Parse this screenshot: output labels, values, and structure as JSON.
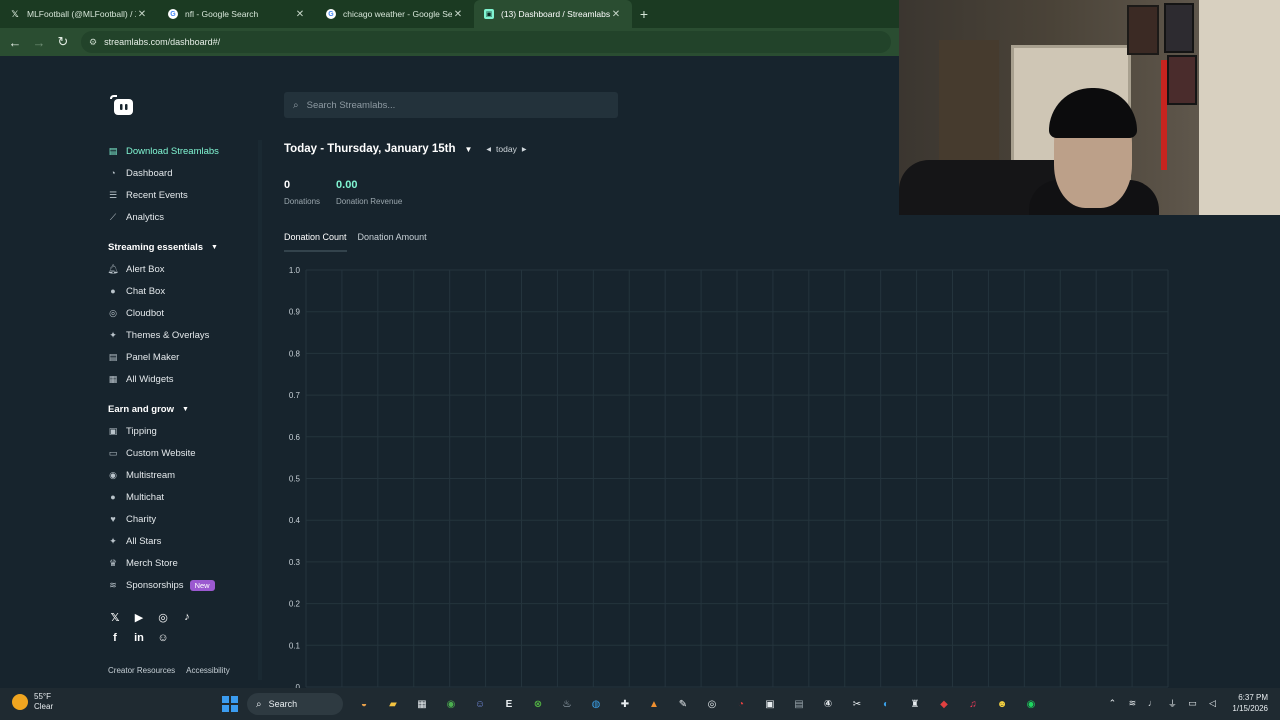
{
  "browser": {
    "tabs": [
      {
        "title": "MLFootball (@MLFootball) / X",
        "icon": "x-icon",
        "active": false
      },
      {
        "title": "nfl - Google Search",
        "icon": "google-icon",
        "active": false
      },
      {
        "title": "chicago weather - Google Search",
        "icon": "google-icon",
        "active": false
      },
      {
        "title": "(13) Dashboard / Streamlabs",
        "icon": "streamlabs-icon",
        "active": true
      }
    ],
    "new_tab_label": "+",
    "url": "streamlabs.com/dashboard#/"
  },
  "search": {
    "placeholder": "Search Streamlabs..."
  },
  "sidebar": {
    "top_items": [
      {
        "label": "Download Streamlabs",
        "icon": "download-icon",
        "highlight": true
      },
      {
        "label": "Dashboard",
        "icon": "dashboard-icon"
      },
      {
        "label": "Recent Events",
        "icon": "list-icon"
      },
      {
        "label": "Analytics",
        "icon": "chart-icon"
      }
    ],
    "streaming_essentials": {
      "title": "Streaming essentials",
      "items": [
        {
          "label": "Alert Box",
          "icon": "bell-icon"
        },
        {
          "label": "Chat Box",
          "icon": "chat-icon"
        },
        {
          "label": "Cloudbot",
          "icon": "bot-icon"
        },
        {
          "label": "Themes & Overlays",
          "icon": "themes-icon"
        },
        {
          "label": "Panel Maker",
          "icon": "panel-icon"
        },
        {
          "label": "All Widgets",
          "icon": "grid-icon"
        }
      ]
    },
    "earn_and_grow": {
      "title": "Earn and grow",
      "items": [
        {
          "label": "Tipping",
          "icon": "tipping-icon"
        },
        {
          "label": "Custom Website",
          "icon": "website-icon"
        },
        {
          "label": "Multistream",
          "icon": "multistream-icon"
        },
        {
          "label": "Multichat",
          "icon": "multichat-icon"
        },
        {
          "label": "Charity",
          "icon": "heart-icon"
        },
        {
          "label": "All Stars",
          "icon": "star-icon"
        },
        {
          "label": "Merch Store",
          "icon": "shirt-icon"
        },
        {
          "label": "Sponsorships",
          "icon": "sponsor-icon",
          "badge": "New"
        }
      ]
    },
    "footer": {
      "creator_resources": "Creator Resources",
      "accessibility": "Accessibility"
    }
  },
  "main": {
    "date_title": "Today - Thursday, January 15th",
    "period_label": "today",
    "stats": [
      {
        "value": "0",
        "label": "Donations"
      },
      {
        "value": "0.00",
        "label": "Donation Revenue"
      }
    ],
    "chart_tabs": [
      "Donation Count",
      "Donation Amount"
    ]
  },
  "chart_data": {
    "type": "line",
    "title": "",
    "xlabel": "",
    "ylabel": "",
    "ylim": [
      0,
      1.0
    ],
    "y_ticks": [
      "1.0",
      "0.9",
      "0.8",
      "0.7",
      "0.6",
      "0.5",
      "0.4",
      "0.3",
      "0.2",
      "0.1",
      "0"
    ],
    "series": [],
    "grid": true
  },
  "taskbar": {
    "weather_temp": "55°F",
    "weather_desc": "Clear",
    "search_label": "Search",
    "time": "6:37 PM",
    "date": "1/15/2026"
  },
  "colors": {
    "accent": "#80f5d2",
    "background": "#17242d",
    "badge": "#9b59d0"
  }
}
